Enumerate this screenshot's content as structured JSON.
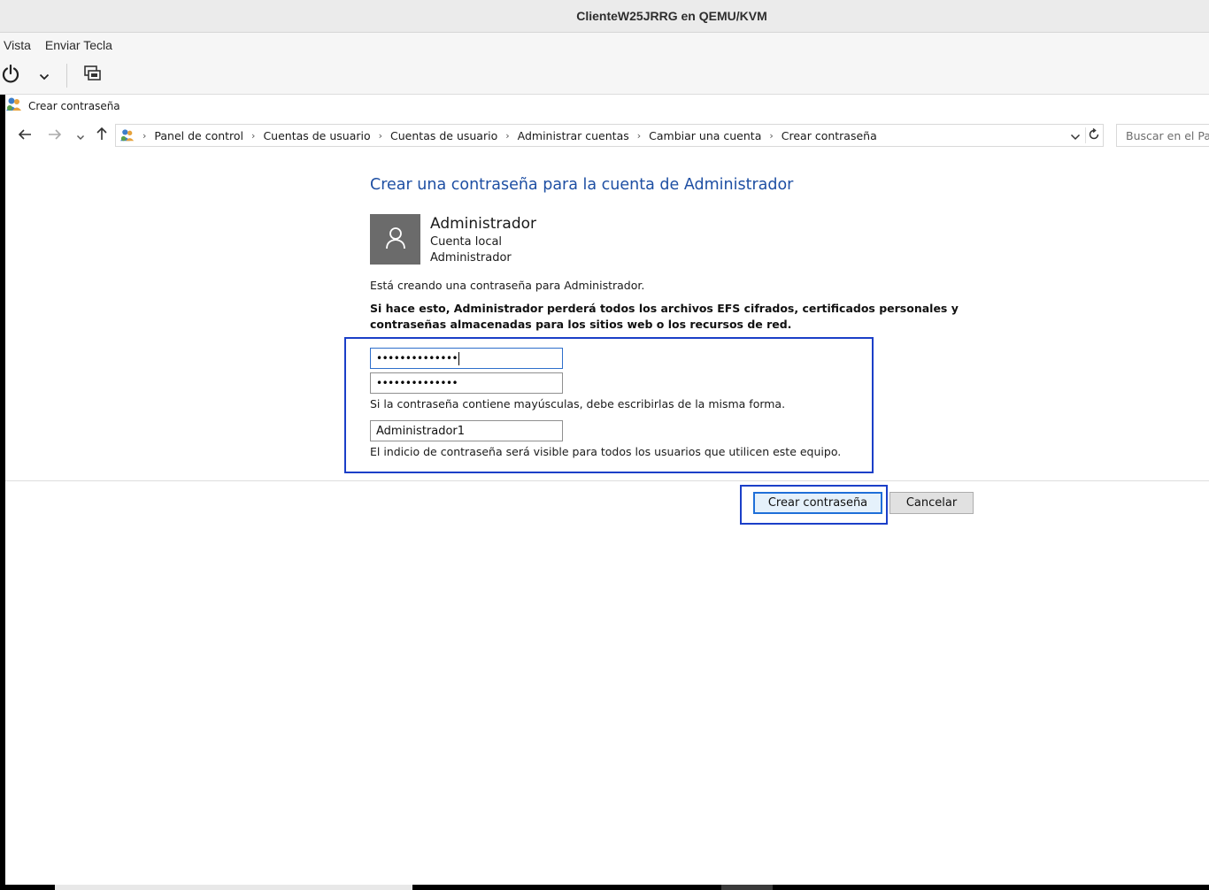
{
  "host": {
    "title": "ClienteW25JRRG en QEMU/KVM",
    "menu": [
      "Vista",
      "Enviar Tecla"
    ],
    "toolbar": {
      "power_icon": "power-icon",
      "dropdown_icon": "chevron-down-icon",
      "screens_icon": "screens-icon"
    }
  },
  "window": {
    "title": "Crear contraseña",
    "icon": "users-icon"
  },
  "navigation": {
    "breadcrumbs": [
      "Panel de control",
      "Cuentas de usuario",
      "Cuentas de usuario",
      "Administrar cuentas",
      "Cambiar una cuenta",
      "Crear contraseña"
    ],
    "search_placeholder": "Buscar en el Pa"
  },
  "page": {
    "heading": "Crear una contraseña para la cuenta de Administrador",
    "account": {
      "name": "Administrador",
      "type": "Cuenta local",
      "role": "Administrador"
    },
    "info": "Está creando una contraseña para Administrador.",
    "warning": "Si hace esto, Administrador perderá todos los archivos EFS cifrados, certificados personales y contraseñas almacenadas para los sitios web o los recursos de red.",
    "new_password_masked": "••••••••••••••",
    "confirm_password_masked": "••••••••••••••",
    "case_note": "Si la contraseña contiene mayúsculas, debe escribirlas de la misma forma.",
    "hint_value": "Administrador1",
    "hint_note": "El indicio de contraseña será visible para todos los usuarios que utilicen este equipo.",
    "create_button": "Crear contraseña",
    "cancel_button": "Cancelar"
  },
  "colors": {
    "heading": "#1e4fa3",
    "focus": "#1b3fc8",
    "avatar_bg": "#6b6b6b"
  }
}
